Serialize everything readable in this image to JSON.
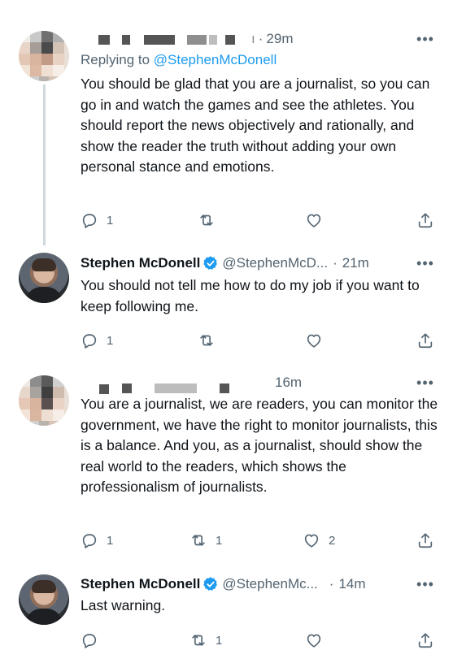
{
  "tweets": [
    {
      "time": "29m",
      "reply_prefix": "Replying to ",
      "reply_mention": "@StephenMcDonell",
      "text": "You should be glad that you are a journalist, so you can go in and watch the games and see the athletes. You should report the news objectively and rationally, and show the reader the truth without adding your own personal stance and emotions.",
      "reply_count": "1",
      "retweet_count": "",
      "like_count": ""
    },
    {
      "name": "Stephen McDonell",
      "handle": "@StephenMcD...",
      "dot": "·",
      "time": "21m",
      "text": "You should not tell me how to do my job if you want to keep following me.",
      "reply_count": "1",
      "retweet_count": "",
      "like_count": ""
    },
    {
      "time": "16m",
      "text": "You are a journalist, we are readers, you can monitor the government, we have the right to monitor journalists, this is a balance. And you, as a journalist, should show the real world to the readers, which shows the professionalism of journalists.",
      "reply_count": "1",
      "retweet_count": "1",
      "like_count": "2"
    },
    {
      "name": "Stephen McDonell",
      "handle": "@StephenMc...",
      "dot": "·",
      "time": "14m",
      "text": "Last warning.",
      "reply_count": "",
      "retweet_count": "1",
      "like_count": ""
    }
  ],
  "common": {
    "more": "•••",
    "dot": "·"
  },
  "icons": {
    "reply": "reply-icon",
    "retweet": "retweet-icon",
    "like": "heart-icon",
    "share": "share-icon",
    "verified": "verified-badge-icon"
  },
  "colors": {
    "link": "#1d9bf0",
    "muted": "#536471",
    "verified": "#1d9bf0"
  }
}
